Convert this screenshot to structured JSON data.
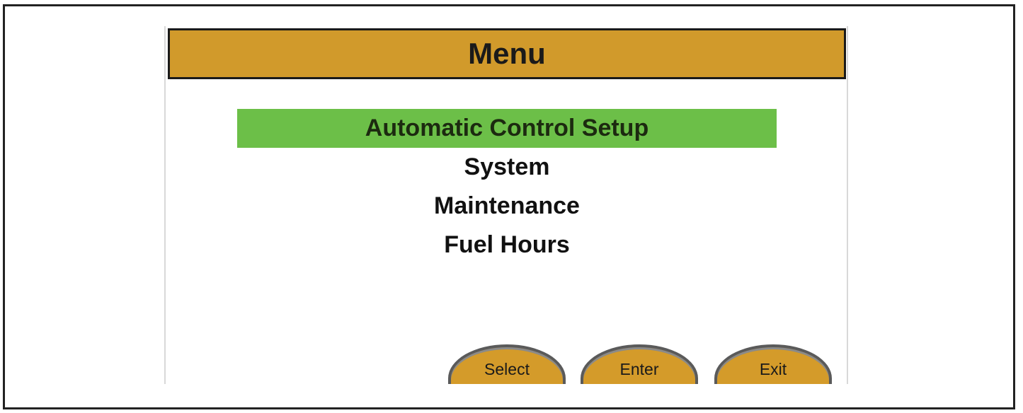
{
  "menu": {
    "title": "Menu",
    "items": [
      {
        "label": "Automatic Control Setup",
        "selected": true
      },
      {
        "label": "System",
        "selected": false
      },
      {
        "label": "Maintenance",
        "selected": false
      },
      {
        "label": "Fuel Hours",
        "selected": false
      }
    ]
  },
  "buttons": {
    "select": "Select",
    "enter": "Enter",
    "exit": "Exit"
  },
  "colors": {
    "title_bar": "#d19a2b",
    "selected_item": "#6cbf48",
    "button_fill": "#d49b2a"
  }
}
